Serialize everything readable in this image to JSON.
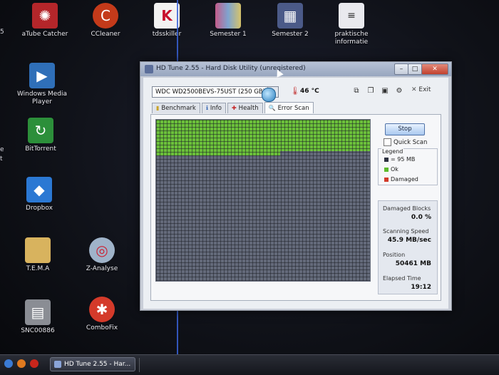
{
  "desktop": {
    "icons": [
      {
        "label": "aTube Catcher",
        "icon": "atube-catcher-icon",
        "color": "#b4262a"
      },
      {
        "label": "CCleaner",
        "icon": "ccleaner-icon",
        "color": "#c43a1a"
      },
      {
        "label": "tdsskiller",
        "icon": "kaspersky-icon",
        "color": "#c8102e"
      },
      {
        "label": "Semester 1",
        "icon": "folder-image-icon",
        "color": "#9a7fb0"
      },
      {
        "label": "Semester 2",
        "icon": "folder-image-icon",
        "color": "#4b5a88"
      },
      {
        "label": "praktische informatie",
        "icon": "document-icon",
        "color": "#e9e9ee"
      },
      {
        "label": "Windows Media Player",
        "icon": "media-player-icon",
        "color": "#2f6fb8"
      },
      {
        "label": "BitTorrent",
        "icon": "bittorrent-icon",
        "color": "#2c8f3a"
      },
      {
        "label": "Dropbox",
        "icon": "dropbox-icon",
        "color": "#2b78d3"
      },
      {
        "label": "T.E.M.A",
        "icon": "folder-icon",
        "color": "#d8b35e"
      },
      {
        "label": "Z-Analyse",
        "icon": "z-analyse-icon",
        "color": "#9fb3c9"
      },
      {
        "label": "SNC00886",
        "icon": "photo-file-icon",
        "color": "#8a8d94"
      },
      {
        "label": "ComboFix",
        "icon": "combofix-icon",
        "color": "#d43a2a"
      }
    ],
    "edge_labels": [
      "5",
      "e",
      "t"
    ]
  },
  "window": {
    "title": "HD Tune 2.55 - Hard Disk Utility (unregistered)",
    "drive": "WDC WD2500BEVS-75UST (250 GB)",
    "temperature": "46 °C",
    "exit_label": "Exit",
    "tabs": [
      "Benchmark",
      "Info",
      "Health",
      "Error Scan"
    ],
    "active_tab": "Error Scan",
    "stop_label": "Stop",
    "quick_scan_label": "Quick Scan",
    "quick_scan_checked": false,
    "legend": {
      "title": "Legend",
      "items": [
        {
          "label": "= 95 MB",
          "color": "#2d3140"
        },
        {
          "label": "Ok",
          "color": "#5dbb2d"
        },
        {
          "label": "Damaged",
          "color": "#d23a2a"
        }
      ]
    },
    "stats": {
      "damaged_blocks_label": "Damaged Blocks",
      "damaged_blocks_value": "0.0 %",
      "scanning_speed_label": "Scanning Speed",
      "scanning_speed_value": "45.9 MB/sec",
      "position_label": "Position",
      "position_value": "50461 MB",
      "elapsed_time_label": "Elapsed Time",
      "elapsed_time_value": "19:12"
    },
    "scan_progress_fraction": 0.2
  },
  "taskbar": {
    "task_label": "HD Tune 2.55 - Har..."
  }
}
